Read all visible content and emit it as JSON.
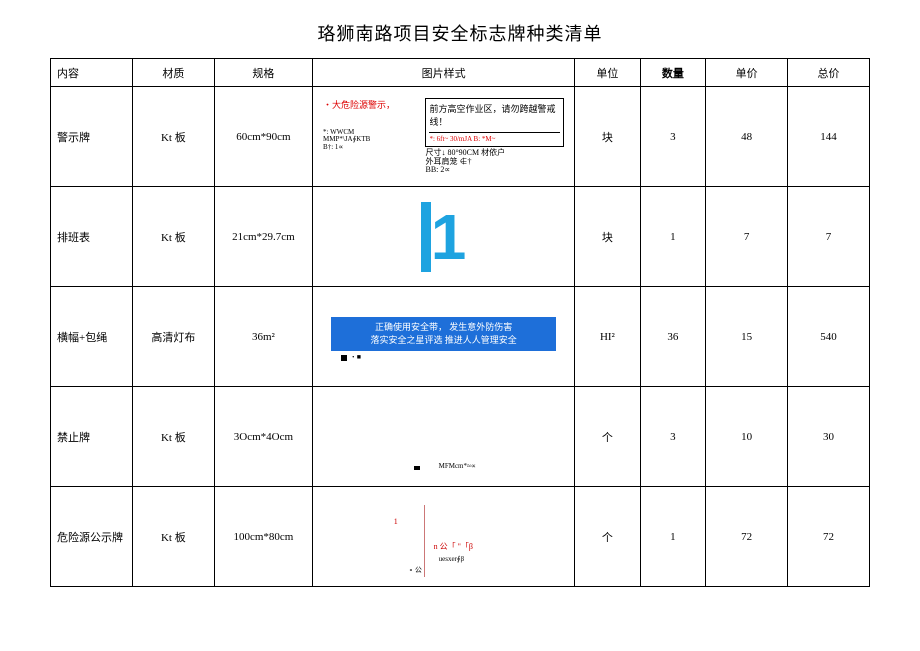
{
  "title": "珞狮南路项目安全标志牌种类清单",
  "headers": {
    "content": "内容",
    "material": "材质",
    "spec": "规格",
    "image": "图片样式",
    "unit": "单位",
    "qty": "数量",
    "uprice": "单价",
    "total": "总价"
  },
  "rows": [
    {
      "content": "警示牌",
      "material": "Kt 板",
      "spec": "60cm*90cm",
      "sample": {
        "red_text": "・大危险源警示，",
        "tiny1": "*:  WWCM",
        "tiny2": "MMP*\\JA∮KTB",
        "tiny3": "B†: 1∝",
        "box_text": "前方高空作业区，请勿跨越警戒线！",
        "box_small": "*:  6ft~  30/mJA      B:  *M~",
        "foot1": "尺寸↓ 80°90CM 材依户",
        "foot2": "外耳肩笼 ∉†",
        "foot3": "BB: 2∝"
      },
      "unit": "块",
      "qty": "3",
      "uprice": "48",
      "total": "144"
    },
    {
      "content": "排班表",
      "material": "Kt 板",
      "spec": "21cm*29.7cm",
      "sample": {
        "num": "1"
      },
      "unit": "块",
      "qty": "1",
      "uprice": "7",
      "total": "7"
    },
    {
      "content": "横幅+包绳",
      "material": "高清灯布",
      "spec": "36m²",
      "sample": {
        "line1": "正确使用安全带，      发生意外防伤害",
        "line2": "落实安全之星评选      推进人人管理安全",
        "dot_label": "・■"
      },
      "unit": "HI²",
      "qty": "36",
      "uprice": "15",
      "total": "540"
    },
    {
      "content": "禁止牌",
      "material": "Kt 板",
      "spec": "3Ocm*4Ocm",
      "sample": {
        "tiny": "MFMcm*≈∝"
      },
      "unit": "个",
      "qty": "3",
      "uprice": "10",
      "total": "30"
    },
    {
      "content": "危险源公示牌",
      "material": "Kt 板",
      "spec": "100cm*80cm",
      "sample": {
        "one": "1",
        "g": "n 公「  \"「β",
        "u": "uesxer∮β",
        "p": "∘ 公"
      },
      "unit": "个",
      "qty": "1",
      "uprice": "72",
      "total": "72"
    }
  ]
}
